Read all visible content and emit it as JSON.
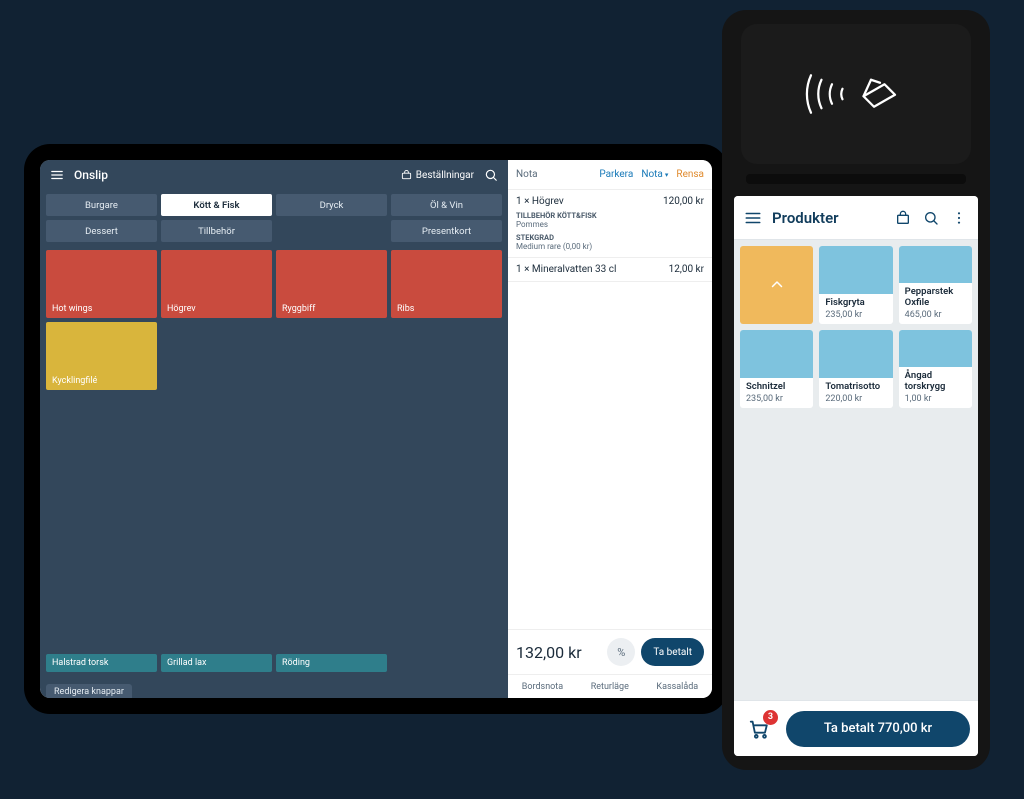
{
  "tablet": {
    "app_name": "Onslip",
    "bestallningar_label": "Beställningar",
    "categories_row1": [
      "Burgare",
      "Kött & Fisk",
      "Dryck",
      "Öl & Vin"
    ],
    "categories_row2": [
      "Dessert",
      "Tillbehör",
      "",
      "Presentkort"
    ],
    "active_category_index": 1,
    "products": [
      {
        "name": "Hot wings",
        "color": "red"
      },
      {
        "name": "Högrev",
        "color": "red"
      },
      {
        "name": "Ryggbiff",
        "color": "red"
      },
      {
        "name": "Ribs",
        "color": "red"
      },
      {
        "name": "Kycklingfilé",
        "color": "yellow"
      },
      {
        "name": "",
        "color": "blank"
      },
      {
        "name": "",
        "color": "blank"
      },
      {
        "name": "",
        "color": "blank"
      },
      {
        "name": "",
        "color": "blank"
      },
      {
        "name": "",
        "color": "blank"
      },
      {
        "name": "",
        "color": "blank"
      },
      {
        "name": "",
        "color": "blank"
      },
      {
        "name": "Halstrad torsk",
        "color": "teal"
      },
      {
        "name": "Grillad lax",
        "color": "teal"
      },
      {
        "name": "Röding",
        "color": "teal"
      },
      {
        "name": "",
        "color": "blank"
      }
    ],
    "edit_buttons_label": "Redigera knappar",
    "order": {
      "title": "Nota",
      "actions": {
        "park": "Parkera",
        "nota": "Nota",
        "clear": "Rensa"
      },
      "lines": [
        {
          "qty": "1 ×",
          "name": "Högrev",
          "price": "120,00 kr",
          "mods": [
            {
              "header": "TILLBEHÖR KÖTT&FISK",
              "value": "Pommes"
            },
            {
              "header": "STEKGRAD",
              "value": "Medium rare (0,00 kr)"
            }
          ]
        },
        {
          "qty": "1 ×",
          "name": "Mineralvatten 33 cl",
          "price": "12,00 kr",
          "mods": []
        }
      ],
      "total": "132,00 kr",
      "percent_label": "%",
      "pay_label": "Ta betalt",
      "footer": [
        "Bordsnota",
        "Returläge",
        "Kassalåda"
      ]
    }
  },
  "terminal": {
    "title": "Produkter",
    "products": [
      {
        "back": true
      },
      {
        "name": "Fiskgryta",
        "price": "235,00 kr"
      },
      {
        "name": "Pepparstek Oxfile",
        "price": "465,00 kr"
      },
      {
        "name": "Schnitzel",
        "price": "235,00 kr"
      },
      {
        "name": "Tomatrisotto",
        "price": "220,00 kr"
      },
      {
        "name": "Ångad torskrygg",
        "price": "1,00 kr"
      }
    ],
    "cart_count": "3",
    "pay_label": "Ta betalt 770,00 kr"
  }
}
